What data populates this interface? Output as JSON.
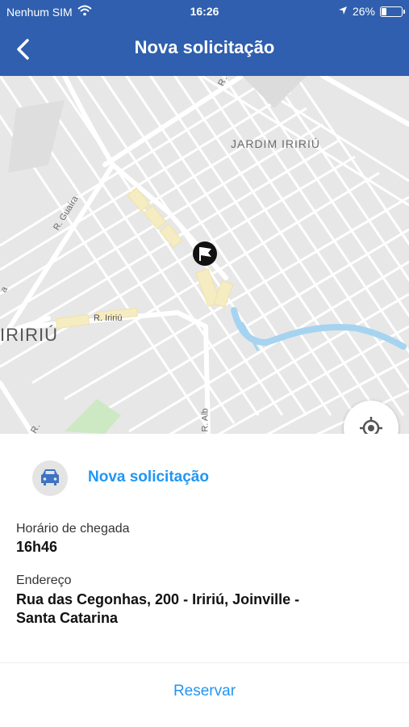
{
  "status_bar": {
    "carrier": "Nenhum SIM",
    "time": "16:26",
    "battery": "26%",
    "icons": [
      "wifi-icon",
      "location-arrow-icon",
      "battery-icon"
    ]
  },
  "nav": {
    "title": "Nova solicitação",
    "back_icon": "chevron-left-icon"
  },
  "map": {
    "labels": {
      "r_top": "R.",
      "neighborhood": "JARDIM IRIRIÚ",
      "r_guaira": "R. Guaíra",
      "r_iririu": "R. Iririú",
      "big_iririu": "IRIRIÚ",
      "r_alb": "R. Alb",
      "r_left": "R.",
      "a_left": "a"
    },
    "marker_icon": "flag-icon",
    "locate_icon": "crosshair-icon"
  },
  "details": {
    "request_title": "Nova solicitação",
    "car_icon": "car-icon",
    "arrival_label": "Horário de chegada",
    "arrival_value": "16h46",
    "address_label": "Endereço",
    "address_line1": "Rua das Cegonhas, 200 - Iririú, Joinville -",
    "address_line2": "Santa Catarina"
  },
  "actions": {
    "reserve": "Reservar"
  },
  "colors": {
    "nav_bg": "#2f5fae",
    "accent": "#2196f3",
    "map_bg": "#e7e7e7",
    "river": "#a6d4f0",
    "park": "#cde9c4",
    "highlight": "#f6ecc2"
  }
}
